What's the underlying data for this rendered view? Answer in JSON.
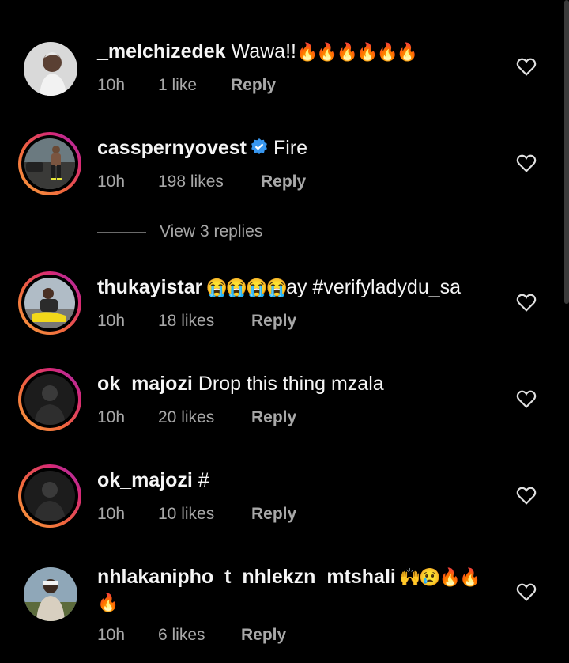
{
  "comments": [
    {
      "username": "_melchizedek",
      "text": " Wawa!!",
      "emoji": "🔥🔥🔥🔥🔥🔥",
      "time": "10h",
      "likes": "1 like",
      "reply": "Reply"
    },
    {
      "username": "casspernyovest",
      "text": "Fire",
      "time": "10h",
      "likes": "198 likes",
      "reply": "Reply",
      "verified": true
    },
    {
      "username": "thukayistar",
      "emoji": " 😭😭😭😭",
      "text": "ay #verifyladydu_sa",
      "time": "10h",
      "likes": "18 likes",
      "reply": "Reply"
    },
    {
      "username": "ok_majozi",
      "text": " Drop this thing mzala",
      "time": "10h",
      "likes": "20 likes",
      "reply": "Reply"
    },
    {
      "username": "ok_majozi",
      "text": " #",
      "time": "10h",
      "likes": "10 likes",
      "reply": "Reply"
    },
    {
      "username": "nhlakanipho_t_nhlekzn_mtshali",
      "emoji": " 🙌😢🔥🔥",
      "emoji2": "🔥",
      "time": "10h",
      "likes": "6 likes",
      "reply": "Reply"
    }
  ],
  "view_replies": "View 3 replies",
  "icons": {
    "like": "heart-outline-icon",
    "verified": "verified-badge-icon"
  },
  "colors": {
    "background": "#000000",
    "secondary_text": "#a8a8a8",
    "verified": "#3897f0"
  }
}
